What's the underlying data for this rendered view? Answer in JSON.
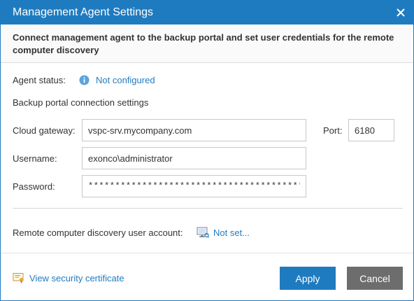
{
  "window": {
    "title": "Management Agent Settings"
  },
  "header": {
    "description": "Connect management agent to the backup portal and set user credentials for the remote computer discovery"
  },
  "agent_status": {
    "label": "Agent status:",
    "value": "Not configured",
    "icon": "info-icon"
  },
  "connection": {
    "section_label": "Backup portal connection settings",
    "cloud_gateway_label": "Cloud gateway:",
    "cloud_gateway_value": "vspc-srv.mycompany.com",
    "port_label": "Port:",
    "port_value": "6180",
    "username_label": "Username:",
    "username_value": "exonco\\administrator",
    "password_label": "Password:",
    "password_value": "****************************************"
  },
  "discovery": {
    "label": "Remote computer discovery user account:",
    "value": "Not set...",
    "icon": "computer-icon"
  },
  "footer": {
    "certificate_link": "View security certificate",
    "certificate_icon": "certificate-icon",
    "apply_label": "Apply",
    "cancel_label": "Cancel"
  },
  "colors": {
    "accent": "#1f7bc0",
    "cancel_button": "#6d6d6d"
  }
}
